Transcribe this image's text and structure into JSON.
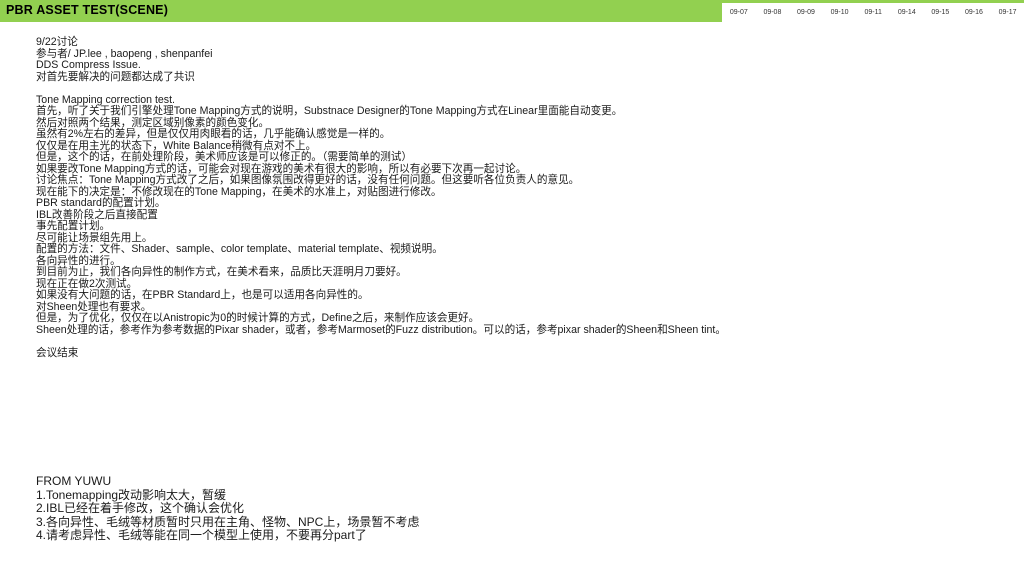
{
  "header": {
    "title": "PBR ASSET TEST(SCENE)",
    "dates": [
      "09-07",
      "09-08",
      "09-09",
      "09-10",
      "09-11",
      "09-14",
      "09-15",
      "09-16",
      "09-17"
    ],
    "accent_color": "#92d050"
  },
  "notes": [
    "9/22讨论",
    "参与者/ JP.lee , baopeng , shenpanfei",
    "DDS Compress Issue.",
    "对首先要解决的问题都达成了共识",
    "",
    "Tone Mapping correction test.",
    "首先，听了关于我们引擎处理Tone Mapping方式的说明，Substnace Designer的Tone Mapping方式在Linear里面能自动变更。",
    "然后对照两个结果，测定区域别像素的颜色变化。",
    "虽然有2%左右的差异，但是仅仅用肉眼看的话，几乎能确认感觉是一样的。",
    "仅仅是在用主光的状态下，White Balance稍微有点对不上。",
    "但是，这个的话，在前处理阶段，美术师应该是可以修正的。（需要简单的测试）",
    "如果要改Tone Mapping方式的话，可能会对现在游戏的美术有很大的影响，所以有必要下次再一起讨论。",
    "讨论焦点：Tone Mapping方式改了之后，如果图像氛围改得更好的话，没有任何问题。但这要听各位负责人的意见。",
    "现在能下的决定是：不修改现在的Tone Mapping，在美术的水准上，对贴图进行修改。",
    "PBR standard的配置计划。",
    "IBL改善阶段之后直接配置",
    "事先配置计划。",
    "尽可能让场景组先用上。",
    "配置的方法：文件、Shader、sample、color template、material template、视频说明。",
    "各向异性的进行。",
    "到目前为止，我们各向异性的制作方式，在美术看来，品质比天涯明月刀要好。",
    "现在正在做2次测试。",
    "如果没有大问题的话，在PBR Standard上，也是可以适用各向异性的。",
    "对Sheen处理也有要求。",
    "但是，为了优化，仅仅在以Anistropic为0的时候计算的方式，Define之后，来制作应该会更好。",
    "Sheen处理的话，参考作为参考数据的Pixar shader，或者，参考Marmoset的Fuzz distribution。可以的话，参考pixar shader的Sheen和Sheen tint。",
    "",
    "会议结束"
  ],
  "yuwu": [
    "FROM YUWU",
    "1.Tonemapping改动影响太大，暂缓",
    "2.IBL已经在着手修改，这个确认会优化",
    "3.各向异性、毛绒等材质暂时只用在主角、怪物、NPC上，场景暂不考虑",
    "4.请考虑异性、毛绒等能在同一个模型上使用，不要再分part了"
  ]
}
